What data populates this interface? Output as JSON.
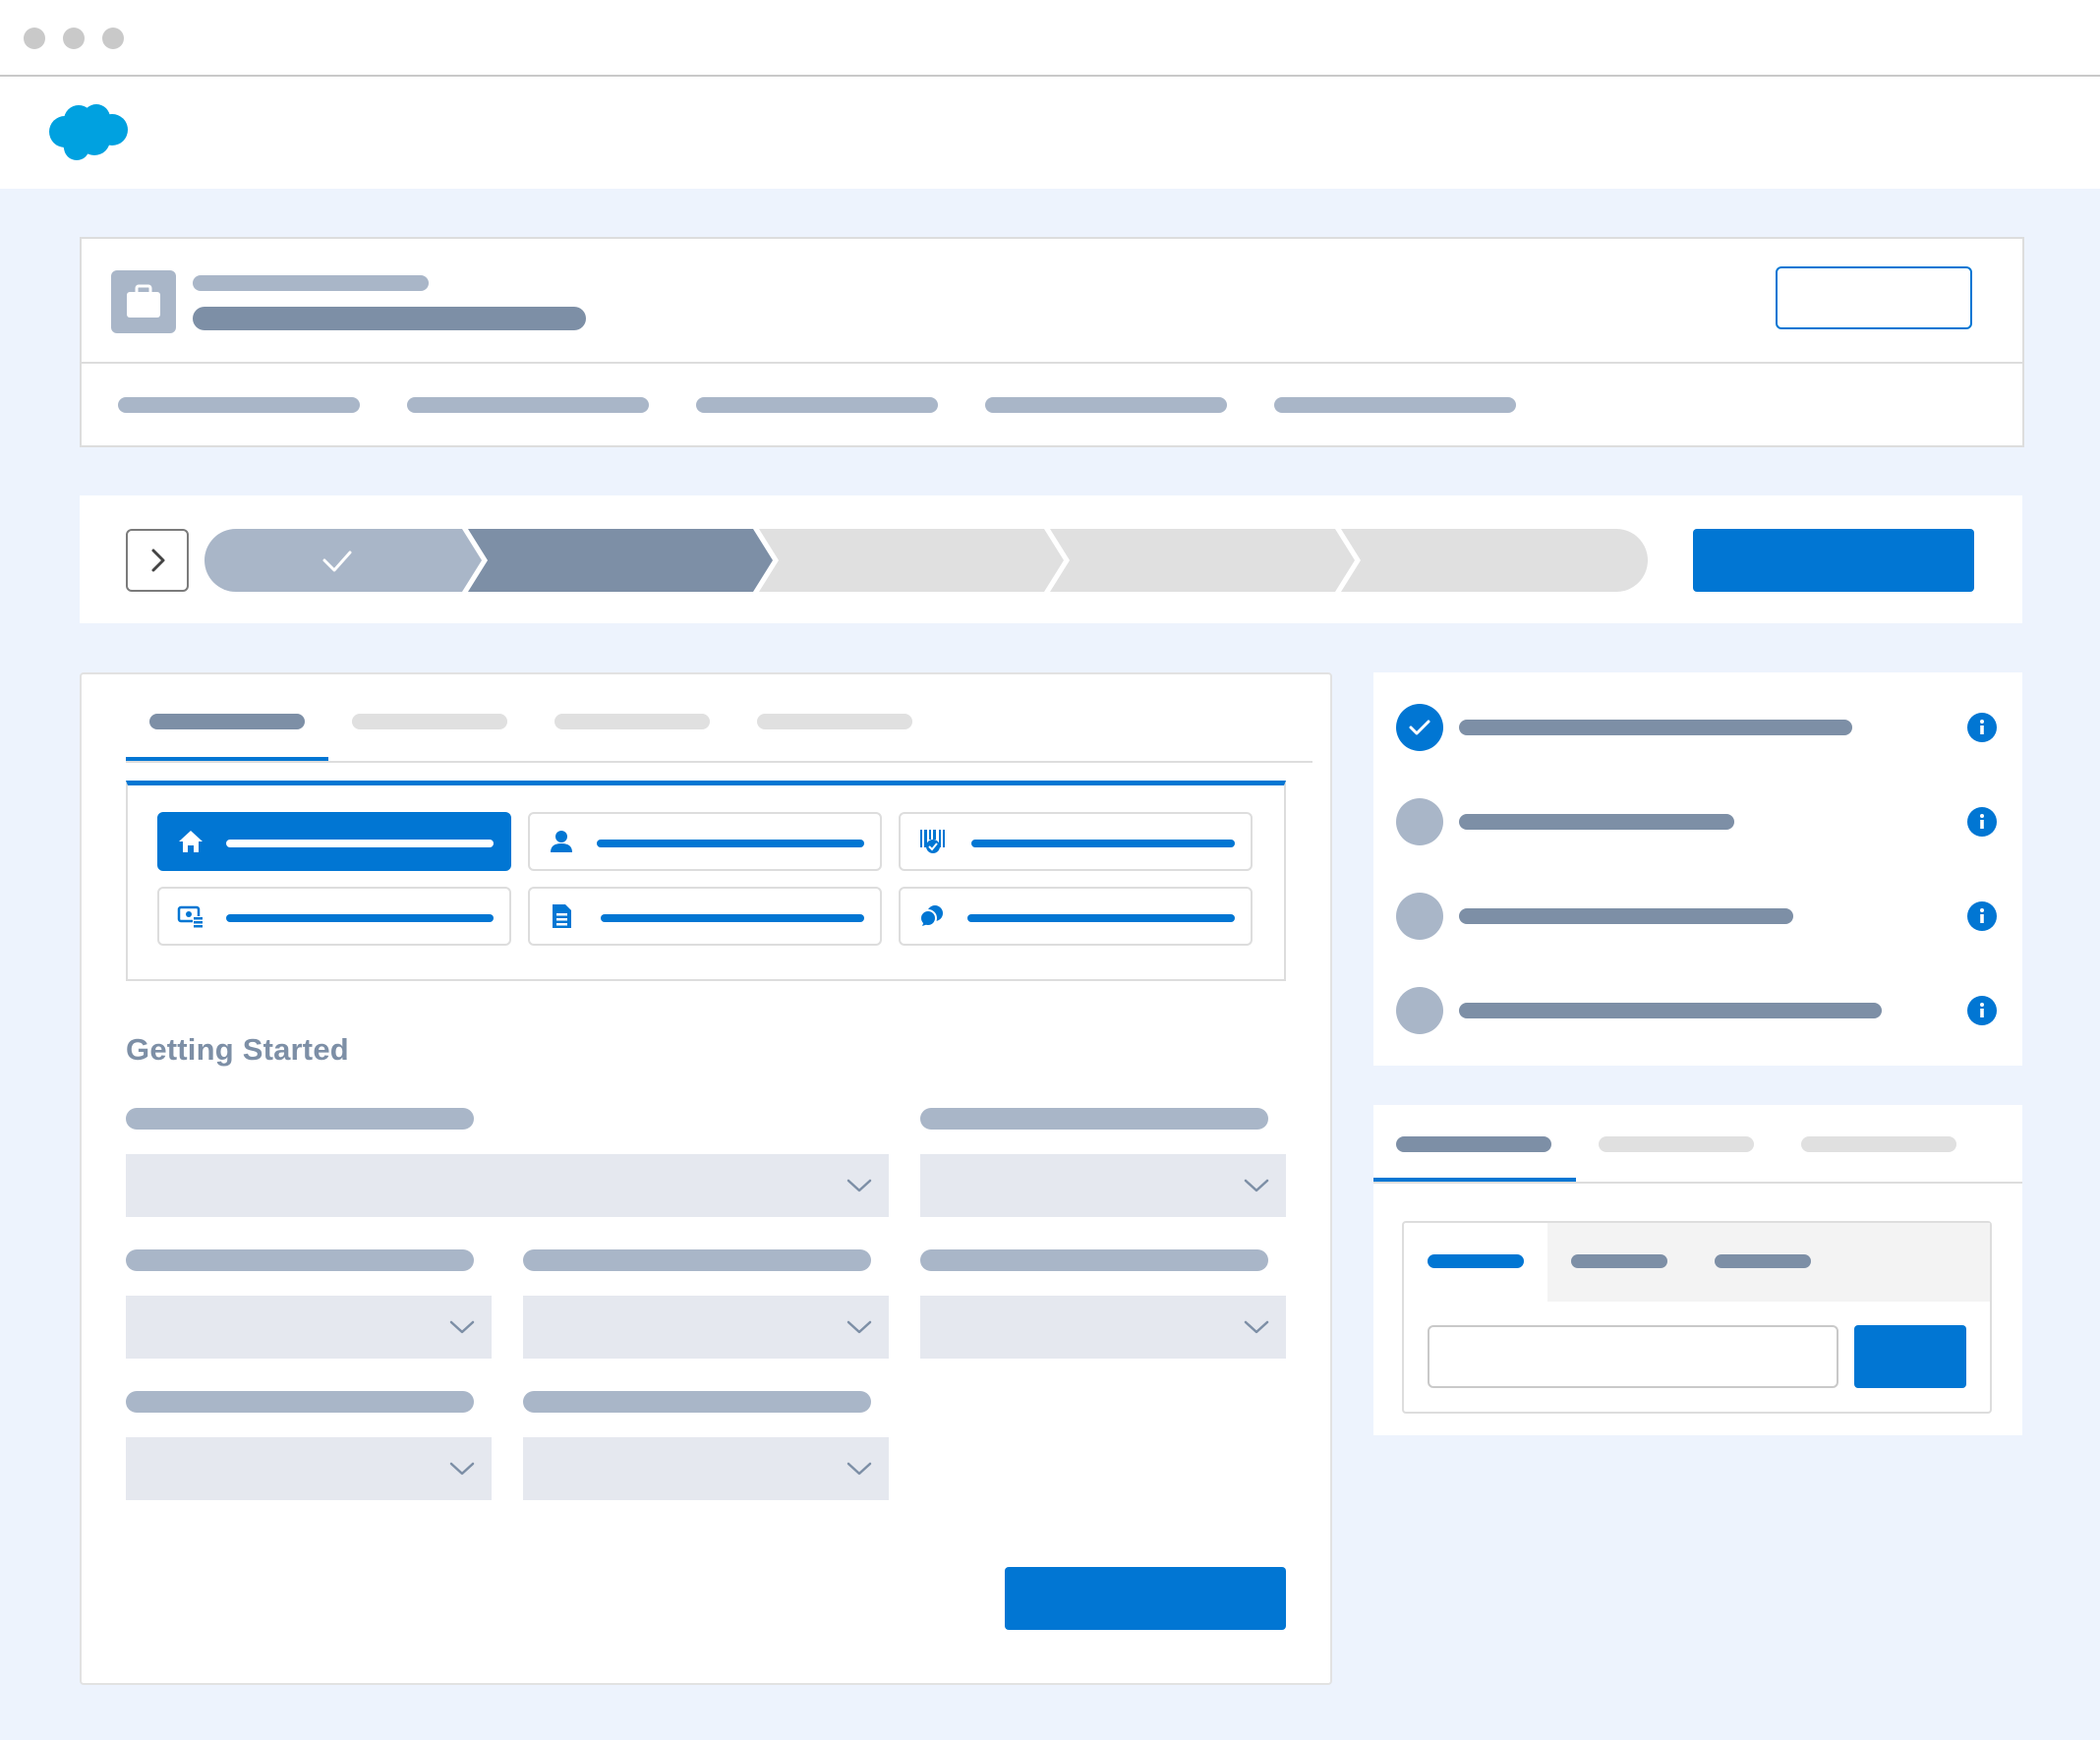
{
  "main": {
    "section_title": "Getting Started"
  },
  "theme": {
    "brand_blue": "#0176d3",
    "logo_blue": "#00a1e0",
    "placeholder_gray": "#a9b6c8",
    "placeholder_dark": "#7d8fa6",
    "canvas_background": "#edf3fd"
  },
  "path": {
    "stages": [
      "complete",
      "current",
      "incomplete",
      "incomplete",
      "incomplete"
    ]
  },
  "checklist": {
    "items": [
      {
        "status": "complete"
      },
      {
        "status": "incomplete"
      },
      {
        "status": "incomplete"
      },
      {
        "status": "incomplete"
      }
    ]
  },
  "icons": {
    "logo": "salesforce-cloud-logo",
    "record": "briefcase-icon",
    "tiles": [
      "home-icon",
      "person-icon",
      "barcode-shield-icon",
      "money-card-icon",
      "document-icon",
      "chat-icon"
    ],
    "select": "chevron-down-icon",
    "path_toggle": "chevron-right-icon",
    "info": "info-icon"
  }
}
